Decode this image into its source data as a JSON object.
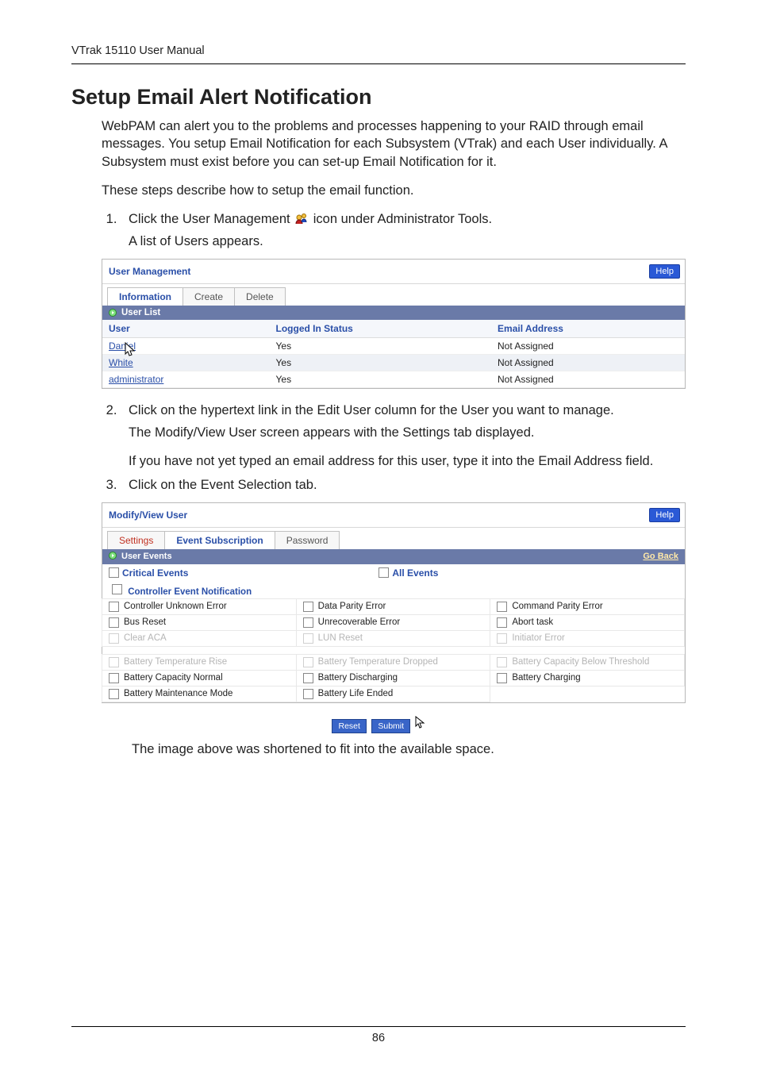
{
  "header": "VTrak 15110 User Manual",
  "page_number": "86",
  "title": "Setup Email Alert Notification",
  "intro_p1": "WebPAM can alert you to the problems and processes happening to your RAID through email messages. You setup Email Notification for each Subsystem (VTrak) and each User individually. A Subsystem must exist before you can set-up Email Notification for it.",
  "intro_p2": "These steps describe how to setup the email function.",
  "steps": {
    "s1a": "Click the User Management ",
    "s1b": " icon under Administrator Tools.",
    "s1c": "A list of Users appears.",
    "s2a": "Click on the hypertext link in the Edit User column for the User you want to manage.",
    "s2b": "The Modify/View User screen appears with the Settings tab displayed.",
    "s2c": "If you have not yet typed an email address for this user, type it into the Email Address field.",
    "s3": "Click on the Event Selection tab."
  },
  "panel1": {
    "title": "User Management",
    "help": "Help",
    "tabs": [
      "Information",
      "Create",
      "Delete"
    ],
    "listHeader": "User List",
    "cols": [
      "User",
      "Logged In Status",
      "Email Address"
    ],
    "rows": [
      {
        "user": "Daniel",
        "status": "Yes",
        "email": "Not Assigned"
      },
      {
        "user": "White",
        "status": "Yes",
        "email": "Not Assigned"
      },
      {
        "user": "administrator",
        "status": "Yes",
        "email": "Not Assigned"
      }
    ]
  },
  "panel2": {
    "title": "Modify/View User",
    "help": "Help",
    "tabs": [
      "Settings",
      "Event Subscription",
      "Password"
    ],
    "listHeader": "User Events",
    "goBack": "Go Back",
    "topChecks": {
      "critical": "Critical Events",
      "all": "All Events"
    },
    "subHeader": "Controller Event Notification",
    "grid1": [
      {
        "t": "Controller Unknown Error"
      },
      {
        "t": "Data Parity Error"
      },
      {
        "t": "Command Parity Error"
      },
      {
        "t": "Bus Reset"
      },
      {
        "t": "Unrecoverable Error"
      },
      {
        "t": "Abort task"
      },
      {
        "t": "Clear ACA",
        "faded": true
      },
      {
        "t": "LUN Reset",
        "faded": true
      },
      {
        "t": "Initiator Error",
        "faded": true
      }
    ],
    "grid2": [
      {
        "t": "Battery Temperature Rise",
        "faded": true
      },
      {
        "t": "Battery Temperature Dropped",
        "faded": true
      },
      {
        "t": "Battery Capacity Below Threshold",
        "faded": true
      },
      {
        "t": "Battery Capacity Normal"
      },
      {
        "t": "Battery Discharging"
      },
      {
        "t": "Battery Charging"
      },
      {
        "t": "Battery Maintenance Mode"
      },
      {
        "t": "Battery Life Ended"
      }
    ],
    "btns": {
      "reset": "Reset",
      "submit": "Submit"
    }
  },
  "closing": "The image above was shortened to fit into the available space."
}
